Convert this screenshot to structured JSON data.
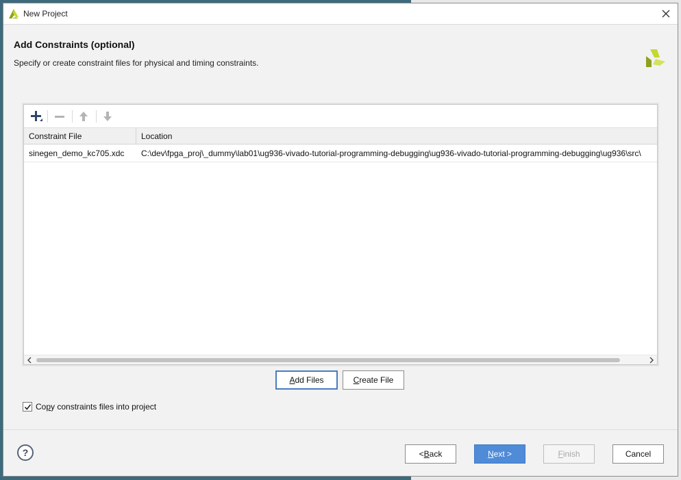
{
  "window": {
    "title": "New Project",
    "close_icon": "close-icon",
    "logo_icon": "vivado-logo-icon"
  },
  "header": {
    "title": "Add Constraints (optional)",
    "subtitle": "Specify or create constraint files for physical and timing constraints."
  },
  "toolbar": {
    "icons": [
      "add-icon",
      "remove-icon",
      "move-up-icon",
      "move-down-icon"
    ]
  },
  "table": {
    "columns": [
      "Constraint File",
      "Location"
    ],
    "rows": [
      {
        "file": "sinegen_demo_kc705.xdc",
        "location": "C:\\dev\\fpga_proj\\_dummy\\lab01\\ug936-vivado-tutorial-programming-debugging\\ug936-vivado-tutorial-programming-debugging\\ug936\\src\\"
      }
    ]
  },
  "actions": {
    "add_files": {
      "pre": "",
      "key": "A",
      "post": "dd Files"
    },
    "create_file": {
      "pre": "",
      "key": "C",
      "post": "reate File"
    }
  },
  "options": {
    "copy_constraints": {
      "pre": "Co",
      "key": "p",
      "post": "y constraints files into project",
      "checked": true
    }
  },
  "footer": {
    "help": "?",
    "back": {
      "pre": "< ",
      "key": "B",
      "post": "ack"
    },
    "next": {
      "pre": "",
      "key": "N",
      "post": "ext >"
    },
    "finish": {
      "pre": "",
      "key": "F",
      "post": "inish"
    },
    "cancel": "Cancel"
  },
  "colors": {
    "accent": "#4f8bd7",
    "focus_border": "#4a7bbf",
    "logo_yellow": "#c4d92e",
    "logo_olive": "#8fa020"
  }
}
